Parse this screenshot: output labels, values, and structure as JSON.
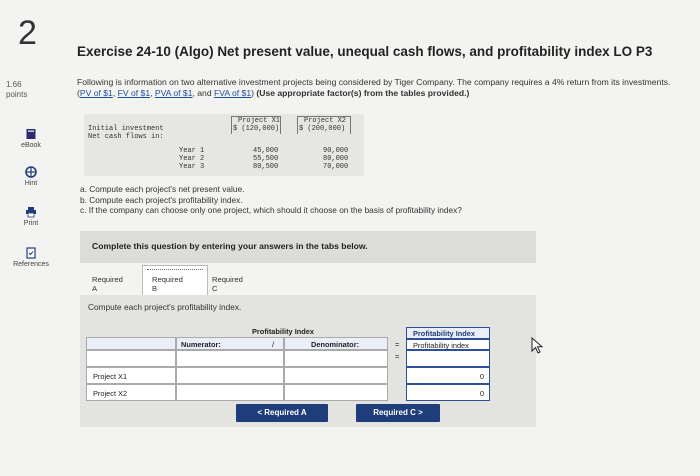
{
  "question": {
    "number": "2",
    "points_value": "1.66",
    "points_label": "points"
  },
  "sidebar": {
    "items": [
      {
        "label": "eBook",
        "icon": "ebook-icon"
      },
      {
        "label": "Hint",
        "icon": "hint-icon"
      },
      {
        "label": "Print",
        "icon": "print-icon"
      },
      {
        "label": "References",
        "icon": "references-icon"
      }
    ]
  },
  "exercise": {
    "title": "Exercise 24-10 (Algo) Net present value, unequal cash flows, and profitability index LO P3",
    "intro_text": "Following is information on two alternative investment projects being considered by Tiger Company. The company requires a 4% return from its investments.",
    "links": [
      "PV of $1",
      "FV of $1",
      "PVA of $1",
      "FVA of $1"
    ],
    "link_sep1": ",",
    "link_sep2": ",",
    "link_sep3": ", and",
    "instruction_bold": "(Use appropriate factor(s) from the tables provided.)",
    "paren_open": "(",
    "paren_close": ")"
  },
  "investment_table": {
    "columns": [
      "Project X1",
      "Project X2"
    ],
    "initial_label": "Initial investment",
    "initial_values": [
      "$ (120,000)",
      "$ (200,000)"
    ],
    "cashflow_label": "Net cash flows in:",
    "years": [
      {
        "label": "Year 1",
        "x1": "45,000",
        "x2": "90,000"
      },
      {
        "label": "Year 2",
        "x1": "55,500",
        "x2": "80,000"
      },
      {
        "label": "Year 3",
        "x1": "80,500",
        "x2": "70,000"
      }
    ]
  },
  "tasks": [
    "a. Compute each project's net present value.",
    "b. Compute each project's profitability index.",
    "c. If the company can choose only one project, which should it choose on the basis of profitability index?"
  ],
  "instruction_box": "Complete this question by entering your answers in the tabs below.",
  "tabs": [
    "Required A",
    "Required B",
    "Required C"
  ],
  "active_tab": "Required B",
  "panel": {
    "prompt": "Compute each project's profitability index.",
    "table_title": "Profitability Index",
    "numerator_label": "Numerator:",
    "slash": "/",
    "denominator_label": "Denominator:",
    "equals": "=",
    "result_header": "Profitability Index",
    "result_subheader": "Profitability index",
    "rows": [
      {
        "label": "Project X1",
        "numerator": "",
        "denominator": "",
        "result": "0"
      },
      {
        "label": "Project X2",
        "numerator": "",
        "denominator": "",
        "result": "0"
      }
    ]
  },
  "nav": {
    "prev": "< Required A",
    "next": "Required C >"
  }
}
